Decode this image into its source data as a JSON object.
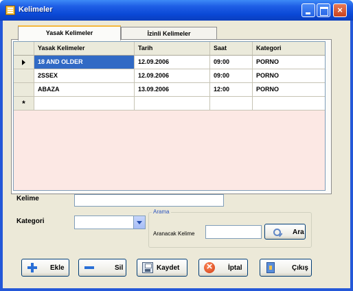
{
  "window": {
    "title": "Kelimeler"
  },
  "tabs": [
    {
      "label": "Yasak Kelimeler",
      "active": true
    },
    {
      "label": "İzinli Kelimeler",
      "active": false
    }
  ],
  "grid": {
    "columns": [
      "Yasak Kelimeler",
      "Tarih",
      "Saat",
      "Kategori"
    ],
    "rows": [
      {
        "marker": "current",
        "word": "18 AND OLDER",
        "date": "12.09.2006",
        "time": "09:00",
        "category": "PORNO"
      },
      {
        "marker": "",
        "word": "2SSEX",
        "date": "12.09.2006",
        "time": "09:00",
        "category": "PORNO"
      },
      {
        "marker": "",
        "word": "ABAZA",
        "date": "13.09.2006",
        "time": "12:00",
        "category": "PORNO"
      }
    ],
    "new_row_marker": "*"
  },
  "form": {
    "kelime_label": "Kelime",
    "kelime_value": "",
    "kategori_label": "Kategori",
    "kategori_value": ""
  },
  "search": {
    "group_title": "Arama",
    "label": "Aranacak Kelime",
    "value": "",
    "button_label": "Ara"
  },
  "buttons": {
    "add": "Ekle",
    "delete": "Sil",
    "save": "Kaydet",
    "cancel": "İptal",
    "exit": "Çıkış"
  },
  "colors": {
    "titlebar": "#0a48d6",
    "selection": "#316ac5",
    "grid_background": "#fce8e4",
    "client_background": "#ece9d8"
  }
}
